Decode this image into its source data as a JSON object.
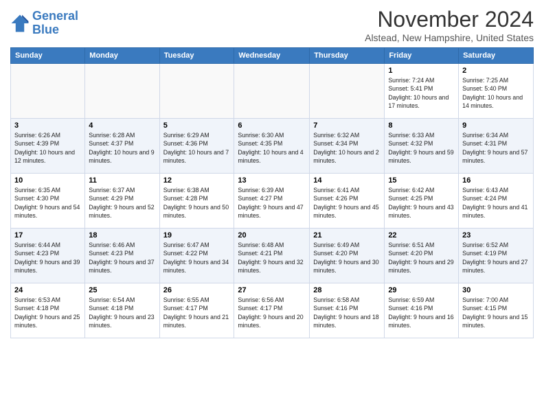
{
  "header": {
    "logo_line1": "General",
    "logo_line2": "Blue",
    "month": "November 2024",
    "location": "Alstead, New Hampshire, United States"
  },
  "weekdays": [
    "Sunday",
    "Monday",
    "Tuesday",
    "Wednesday",
    "Thursday",
    "Friday",
    "Saturday"
  ],
  "weeks": [
    [
      {
        "day": "",
        "info": ""
      },
      {
        "day": "",
        "info": ""
      },
      {
        "day": "",
        "info": ""
      },
      {
        "day": "",
        "info": ""
      },
      {
        "day": "",
        "info": ""
      },
      {
        "day": "1",
        "info": "Sunrise: 7:24 AM\nSunset: 5:41 PM\nDaylight: 10 hours and 17 minutes."
      },
      {
        "day": "2",
        "info": "Sunrise: 7:25 AM\nSunset: 5:40 PM\nDaylight: 10 hours and 14 minutes."
      }
    ],
    [
      {
        "day": "3",
        "info": "Sunrise: 6:26 AM\nSunset: 4:39 PM\nDaylight: 10 hours and 12 minutes."
      },
      {
        "day": "4",
        "info": "Sunrise: 6:28 AM\nSunset: 4:37 PM\nDaylight: 10 hours and 9 minutes."
      },
      {
        "day": "5",
        "info": "Sunrise: 6:29 AM\nSunset: 4:36 PM\nDaylight: 10 hours and 7 minutes."
      },
      {
        "day": "6",
        "info": "Sunrise: 6:30 AM\nSunset: 4:35 PM\nDaylight: 10 hours and 4 minutes."
      },
      {
        "day": "7",
        "info": "Sunrise: 6:32 AM\nSunset: 4:34 PM\nDaylight: 10 hours and 2 minutes."
      },
      {
        "day": "8",
        "info": "Sunrise: 6:33 AM\nSunset: 4:32 PM\nDaylight: 9 hours and 59 minutes."
      },
      {
        "day": "9",
        "info": "Sunrise: 6:34 AM\nSunset: 4:31 PM\nDaylight: 9 hours and 57 minutes."
      }
    ],
    [
      {
        "day": "10",
        "info": "Sunrise: 6:35 AM\nSunset: 4:30 PM\nDaylight: 9 hours and 54 minutes."
      },
      {
        "day": "11",
        "info": "Sunrise: 6:37 AM\nSunset: 4:29 PM\nDaylight: 9 hours and 52 minutes."
      },
      {
        "day": "12",
        "info": "Sunrise: 6:38 AM\nSunset: 4:28 PM\nDaylight: 9 hours and 50 minutes."
      },
      {
        "day": "13",
        "info": "Sunrise: 6:39 AM\nSunset: 4:27 PM\nDaylight: 9 hours and 47 minutes."
      },
      {
        "day": "14",
        "info": "Sunrise: 6:41 AM\nSunset: 4:26 PM\nDaylight: 9 hours and 45 minutes."
      },
      {
        "day": "15",
        "info": "Sunrise: 6:42 AM\nSunset: 4:25 PM\nDaylight: 9 hours and 43 minutes."
      },
      {
        "day": "16",
        "info": "Sunrise: 6:43 AM\nSunset: 4:24 PM\nDaylight: 9 hours and 41 minutes."
      }
    ],
    [
      {
        "day": "17",
        "info": "Sunrise: 6:44 AM\nSunset: 4:23 PM\nDaylight: 9 hours and 39 minutes."
      },
      {
        "day": "18",
        "info": "Sunrise: 6:46 AM\nSunset: 4:23 PM\nDaylight: 9 hours and 37 minutes."
      },
      {
        "day": "19",
        "info": "Sunrise: 6:47 AM\nSunset: 4:22 PM\nDaylight: 9 hours and 34 minutes."
      },
      {
        "day": "20",
        "info": "Sunrise: 6:48 AM\nSunset: 4:21 PM\nDaylight: 9 hours and 32 minutes."
      },
      {
        "day": "21",
        "info": "Sunrise: 6:49 AM\nSunset: 4:20 PM\nDaylight: 9 hours and 30 minutes."
      },
      {
        "day": "22",
        "info": "Sunrise: 6:51 AM\nSunset: 4:20 PM\nDaylight: 9 hours and 29 minutes."
      },
      {
        "day": "23",
        "info": "Sunrise: 6:52 AM\nSunset: 4:19 PM\nDaylight: 9 hours and 27 minutes."
      }
    ],
    [
      {
        "day": "24",
        "info": "Sunrise: 6:53 AM\nSunset: 4:18 PM\nDaylight: 9 hours and 25 minutes."
      },
      {
        "day": "25",
        "info": "Sunrise: 6:54 AM\nSunset: 4:18 PM\nDaylight: 9 hours and 23 minutes."
      },
      {
        "day": "26",
        "info": "Sunrise: 6:55 AM\nSunset: 4:17 PM\nDaylight: 9 hours and 21 minutes."
      },
      {
        "day": "27",
        "info": "Sunrise: 6:56 AM\nSunset: 4:17 PM\nDaylight: 9 hours and 20 minutes."
      },
      {
        "day": "28",
        "info": "Sunrise: 6:58 AM\nSunset: 4:16 PM\nDaylight: 9 hours and 18 minutes."
      },
      {
        "day": "29",
        "info": "Sunrise: 6:59 AM\nSunset: 4:16 PM\nDaylight: 9 hours and 16 minutes."
      },
      {
        "day": "30",
        "info": "Sunrise: 7:00 AM\nSunset: 4:15 PM\nDaylight: 9 hours and 15 minutes."
      }
    ]
  ]
}
